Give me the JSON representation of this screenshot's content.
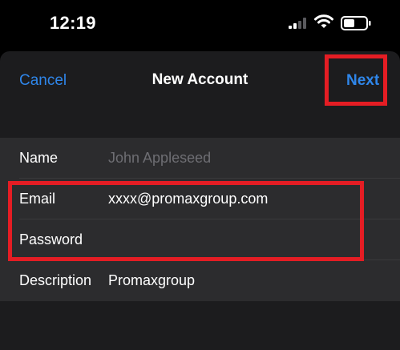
{
  "status_bar": {
    "time": "12:19",
    "icons": [
      "cellular-signal-icon",
      "wifi-icon",
      "battery-icon"
    ]
  },
  "nav": {
    "cancel_label": "Cancel",
    "title": "New Account",
    "next_label": "Next"
  },
  "form": {
    "name": {
      "label": "Name",
      "value": "",
      "placeholder": "John Appleseed"
    },
    "email": {
      "label": "Email",
      "value": "xxxx@promaxgroup.com"
    },
    "password": {
      "label": "Password",
      "value": ""
    },
    "description": {
      "label": "Description",
      "value": "Promaxgroup"
    }
  },
  "colors": {
    "accent": "#2f86ea",
    "highlight": "#e41d24",
    "sheet_bg": "#1c1c1e",
    "row_bg": "#2c2c2e"
  }
}
